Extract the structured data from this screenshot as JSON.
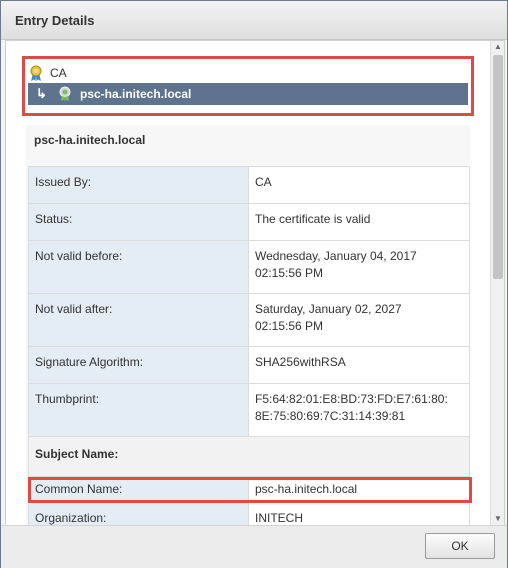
{
  "dialog": {
    "title": "Entry Details"
  },
  "tree": {
    "root": {
      "label": "CA",
      "icon": "certificate-ribbon-icon"
    },
    "child": {
      "label": "psc-ha.initech.local",
      "icon": "certificate-seal-icon",
      "connector_icon": "tree-branch-arrow-icon"
    }
  },
  "details": {
    "title": "psc-ha.initech.local",
    "rows": [
      {
        "key": "Issued By:",
        "value": "CA"
      },
      {
        "key": "Status:",
        "value": "The certificate is valid"
      },
      {
        "key": "Not valid before:",
        "value": "Wednesday, January 04, 2017\n02:15:56 PM"
      },
      {
        "key": "Not valid after:",
        "value": "Saturday, January 02, 2027\n02:15:56 PM"
      },
      {
        "key": "Signature Algorithm:",
        "value": "SHA256withRSA"
      },
      {
        "key": "Thumbprint:",
        "value": "F5:64:82:01:E8:BD:73:FD:E7:61:80:\n8E:75:80:69:7C:31:14:39:81"
      }
    ],
    "subject_section": "Subject Name:",
    "subject_rows": [
      {
        "key": "Common Name:",
        "value": "psc-ha.initech.local"
      },
      {
        "key": "Organization:",
        "value": "INITECH"
      }
    ]
  },
  "footer": {
    "ok_label": "OK"
  },
  "colors": {
    "highlight": "#dd4b45",
    "selected_row": "#5d738e",
    "key_cell": "#e4ecf5"
  }
}
